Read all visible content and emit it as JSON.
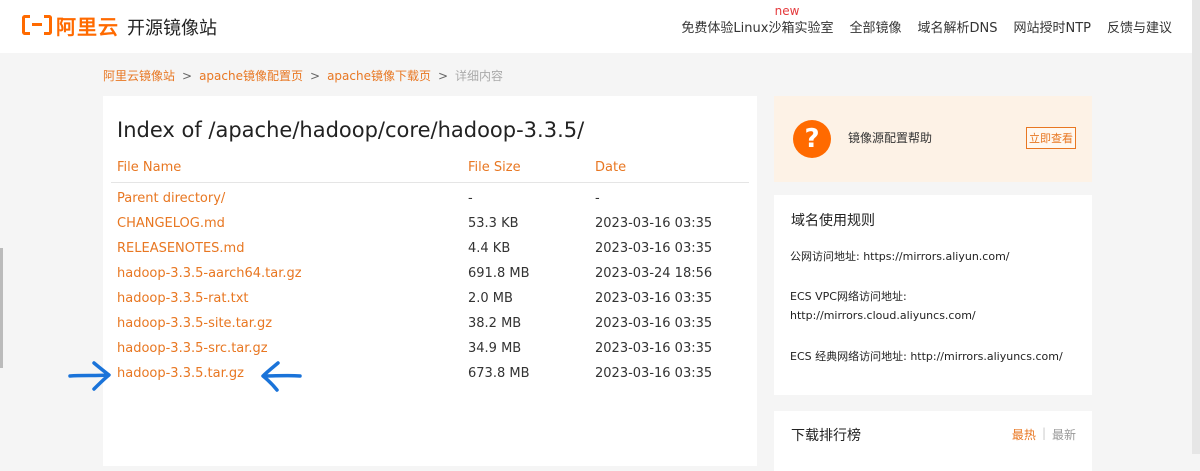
{
  "header": {
    "logo_text": "阿里云",
    "site_title": "开源镜像站",
    "nav": [
      {
        "label": "免费体验Linux沙箱实验室",
        "badge": "new"
      },
      {
        "label": "全部镜像"
      },
      {
        "label": "域名解析DNS"
      },
      {
        "label": "网站授时NTP"
      },
      {
        "label": "反馈与建议"
      }
    ]
  },
  "breadcrumb": {
    "items": [
      "阿里云镜像站",
      "apache镜像配置页",
      "apache镜像下载页"
    ],
    "current": "详细内容",
    "sep": ">"
  },
  "listing": {
    "title": "Index of /apache/hadoop/core/hadoop-3.3.5/",
    "columns": [
      "File Name",
      "File Size",
      "Date"
    ],
    "rows": [
      {
        "name": "Parent directory/",
        "size": "-",
        "date": "-"
      },
      {
        "name": "CHANGELOG.md",
        "size": "53.3 KB",
        "date": "2023-03-16 03:35"
      },
      {
        "name": "RELEASENOTES.md",
        "size": "4.4 KB",
        "date": "2023-03-16 03:35"
      },
      {
        "name": "hadoop-3.3.5-aarch64.tar.gz",
        "size": "691.8 MB",
        "date": "2023-03-24 18:56"
      },
      {
        "name": "hadoop-3.3.5-rat.txt",
        "size": "2.0 MB",
        "date": "2023-03-16 03:35"
      },
      {
        "name": "hadoop-3.3.5-site.tar.gz",
        "size": "38.2 MB",
        "date": "2023-03-16 03:35"
      },
      {
        "name": "hadoop-3.3.5-src.tar.gz",
        "size": "34.9 MB",
        "date": "2023-03-16 03:35"
      },
      {
        "name": "hadoop-3.3.5.tar.gz",
        "size": "673.8 MB",
        "date": "2023-03-16 03:35"
      }
    ]
  },
  "help": {
    "icon": "question-icon",
    "text": "镜像源配置帮助",
    "button": "立即查看"
  },
  "rules": {
    "title": "域名使用规则",
    "public_label": "公网访问地址: ",
    "public_url": "https://mirrors.aliyun.com/",
    "vpc_label": "ECS VPC网络访问地址:",
    "vpc_url": "http://mirrors.cloud.aliyuncs.com/",
    "classic_label": "ECS 经典网络访问地址: ",
    "classic_url": "http://mirrors.aliyuncs.com/"
  },
  "downloads": {
    "title": "下载排行榜",
    "tab_hot": "最热",
    "tab_sep": "|",
    "tab_latest": "最新"
  },
  "colors": {
    "accent": "#ff6a00",
    "link": "#e87722",
    "annotation_arrow": "#1a73d9"
  }
}
